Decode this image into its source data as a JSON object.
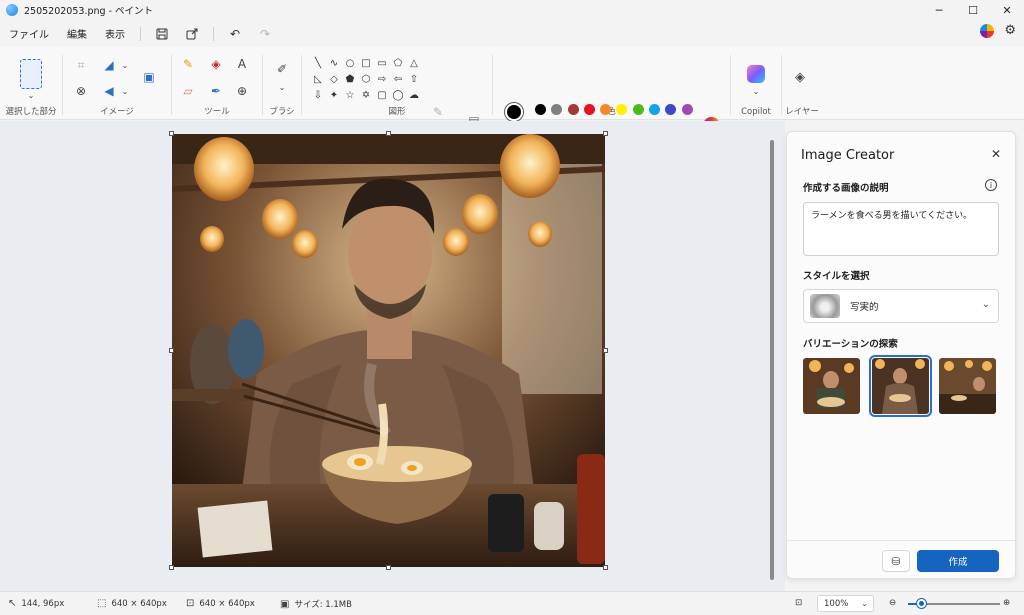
{
  "window": {
    "title": "2505202053.png - ペイント"
  },
  "menu": {
    "file": "ファイル",
    "edit": "編集",
    "view": "表示"
  },
  "ribbon": {
    "selection_label": "選択した部分",
    "image_label": "イメージ",
    "tools_label": "ツール",
    "brushes_label": "ブラシ",
    "shapes_label": "図形",
    "colors_label": "色",
    "copilot_label": "Copilot",
    "layers_label": "レイヤー",
    "primary_color": "#000000",
    "secondary_color": "#ffffff",
    "palette_row1": [
      "#000000",
      "#7f7f7f",
      "#a4373a",
      "#e81123",
      "#f7892b",
      "#fff100",
      "#4cbb17",
      "#0ea5e9",
      "#3f48cc",
      "#9f4bb4"
    ],
    "palette_row2": [
      "#ffffff",
      "#c3c3c3",
      "#b97a57",
      "#f4a6c8",
      "#ffc90e",
      "#efe4b0",
      "#b5e61d",
      "#99d9ea",
      "#7092be",
      "#c8bfe7"
    ]
  },
  "panel": {
    "title": "Image Creator",
    "prompt_label": "作成する画像の説明",
    "prompt_value": "ラーメンを食べる男を描いてください。",
    "style_label": "スタイルを選択",
    "style_value": "写実的",
    "variations_label": "バリエーションの探索",
    "create_button": "作成"
  },
  "status": {
    "cursor": "144, 96px",
    "selection_size": "640 × 640px",
    "canvas_size": "640 × 640px",
    "file_size": "サイズ: 1.1MB",
    "zoom": "100%",
    "zoom_fraction": 0.15
  }
}
